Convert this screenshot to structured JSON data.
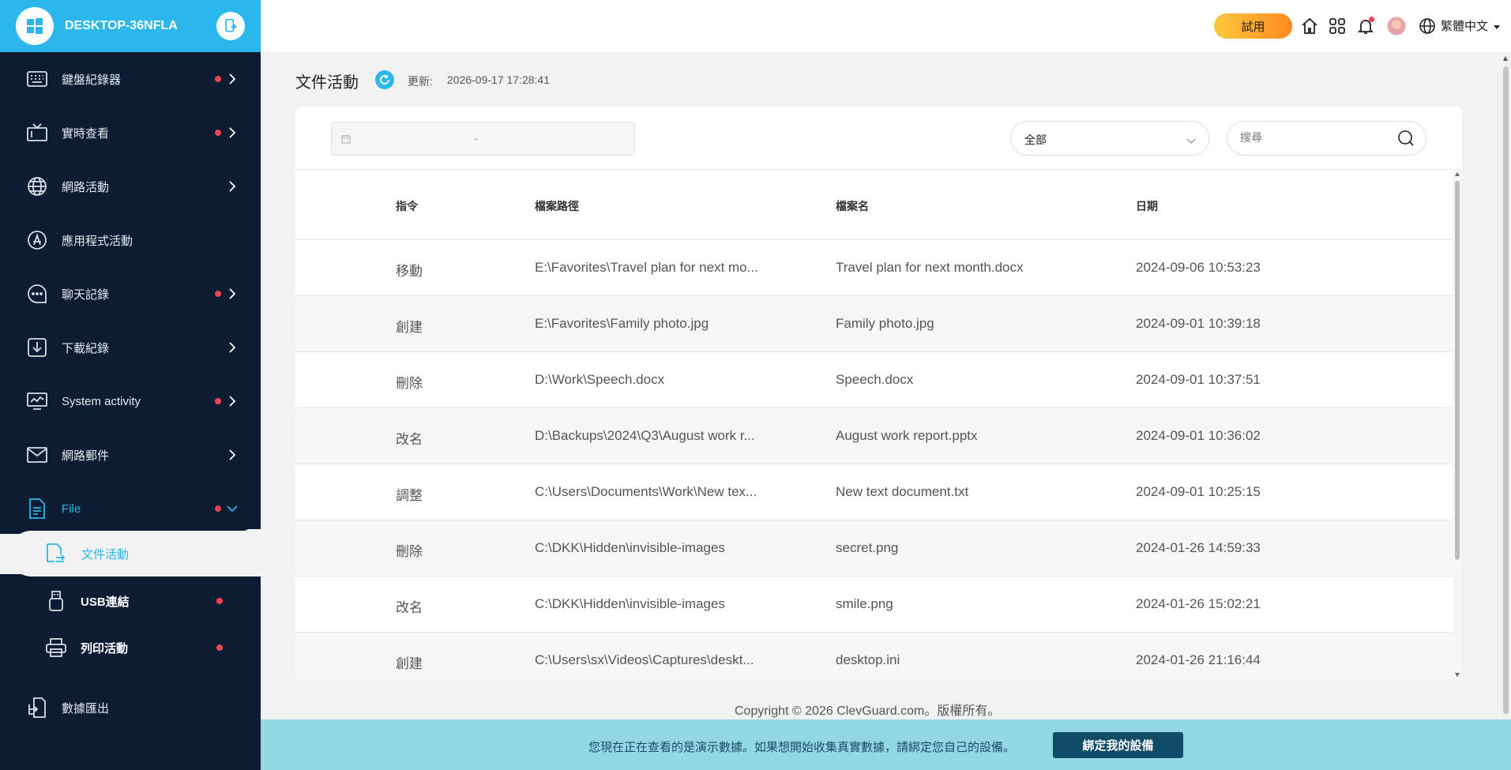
{
  "device": {
    "name": "DESKTOP-36NFLA"
  },
  "sidebar": {
    "items": [
      {
        "label": "鍵盤紀錄器",
        "dot": true,
        "chevron": "right"
      },
      {
        "label": "實時查看",
        "dot": true,
        "chevron": "right"
      },
      {
        "label": "網路活動",
        "dot": false,
        "chevron": "right"
      },
      {
        "label": "應用程式活動",
        "dot": false,
        "chevron": ""
      },
      {
        "label": "聊天記錄",
        "dot": true,
        "chevron": "right"
      },
      {
        "label": "下載紀錄",
        "dot": false,
        "chevron": "right"
      },
      {
        "label": "System activity",
        "dot": true,
        "chevron": "right"
      },
      {
        "label": "網路郵件",
        "dot": false,
        "chevron": "right"
      },
      {
        "label": "File",
        "dot": true,
        "chevron": "down"
      }
    ],
    "subitems": [
      {
        "label": "文件活動",
        "active": true
      },
      {
        "label": "USB連結",
        "dot": true
      },
      {
        "label": "列印活動",
        "dot": true
      }
    ],
    "export_label": "數據匯出"
  },
  "topbar": {
    "trial_label": "試用",
    "language": "繁體中文"
  },
  "page": {
    "title": "文件活動",
    "update_label": "更新:",
    "update_time": "2026-09-17 17:28:41"
  },
  "filters": {
    "date_separator": "-",
    "select_value": "全部",
    "search_placeholder": "搜尋"
  },
  "table": {
    "headers": [
      "指令",
      "檔案路徑",
      "檔案名",
      "日期"
    ],
    "rows": [
      [
        "移動",
        "E:\\Favorites\\Travel plan for next mo...",
        "Travel plan for next month.docx",
        "2024-09-06 10:53:23"
      ],
      [
        "創建",
        "E:\\Favorites\\Family photo.jpg",
        "Family photo.jpg",
        "2024-09-01 10:39:18"
      ],
      [
        "刪除",
        "D:\\Work\\Speech.docx",
        "Speech.docx",
        "2024-09-01 10:37:51"
      ],
      [
        "改名",
        "D:\\Backups\\2024\\Q3\\August work r...",
        "August work report.pptx",
        "2024-09-01 10:36:02"
      ],
      [
        "調整",
        "C:\\Users\\Documents\\Work\\New tex...",
        "New text document.txt",
        "2024-09-01 10:25:15"
      ],
      [
        "刪除",
        "C:\\DKK\\Hidden\\invisible-images",
        "secret.png",
        "2024-01-26 14:59:33"
      ],
      [
        "改名",
        "C:\\DKK\\Hidden\\invisible-images",
        "smile.png",
        "2024-01-26 15:02:21"
      ],
      [
        "創建",
        "C:\\Users\\sx\\Videos\\Captures\\deskt...",
        "desktop.ini",
        "2024-01-26 21:16:44"
      ]
    ]
  },
  "footer": {
    "copyright": "Copyright © 2026 ClevGuard.com。版權所有。"
  },
  "banner": {
    "text": "您現在正在查看的是演示數據。如果想開始收集真實數據，請綁定您自己的設備。",
    "button": "綁定我的設備"
  },
  "colors": {
    "accent": "#2bb6ec",
    "sidebar_bg": "#0d1b33",
    "dot": "#f0454c",
    "banner_bg": "#92d7e4",
    "banner_button": "#0f4a67"
  }
}
